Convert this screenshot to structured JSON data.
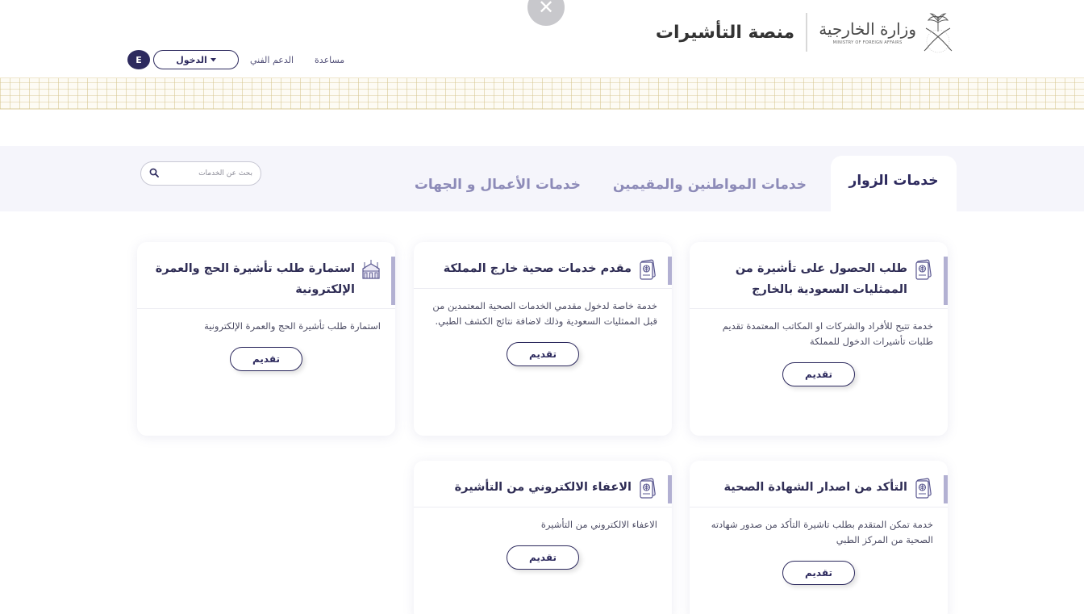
{
  "header": {
    "close_symbol": "✕",
    "ministry_name_ar": "وزارة الخارجية",
    "ministry_name_en": "MINISTRY OF FOREIGN AFFAIRS",
    "platform_title": "منصة التأشيرات",
    "nav": {
      "help": "مساعدة",
      "support": "الدعم الفني",
      "login": "الدخول",
      "language": "E"
    }
  },
  "tabs": [
    {
      "label": "خدمات الزوار",
      "active": true
    },
    {
      "label": "خدمات المواطنين والمقيمين",
      "active": false
    },
    {
      "label": "خدمات الأعمال و الجهات",
      "active": false
    }
  ],
  "search": {
    "placeholder": "بحث عن الخدمات",
    "icon": "search-icon"
  },
  "cards": [
    {
      "title": "طلب الحصول على تأشيرة من الممثليات السعودية بالخارج",
      "description": "خدمة تتيح للأفراد والشركات او المكاتب المعتمدة تقديم طلبات تأشيرات الدخول للمملكة",
      "button": "تقديم",
      "icon": "passport-icon"
    },
    {
      "title": "مقدم خدمات صحية خارج المملكة",
      "description": "خدمة خاصة لدخول مقدمي الخدمات الصحية المعتمدين من قبل الممثليات السعودية وذلك لاضافة نتائج الكشف الطبي.",
      "button": "تقديم",
      "icon": "passport-icon"
    },
    {
      "title": "استمارة طلب تأشيرة الحج والعمرة الإلكترونية",
      "description": "استمارة طلب تأشيرة الحج والعمرة الإلكترونية",
      "button": "تقديم",
      "icon": "kaaba-icon"
    },
    {
      "title": "التأكد من اصدار الشهادة الصحية",
      "description": "خدمة تمكن المتقدم بطلب تاشيرة التأكد من صدور شهادته الصحية من المركز الطبي",
      "button": "تقديم",
      "icon": "passport-icon"
    },
    {
      "title": "الاعفاء الالكتروني من التأشيرة",
      "description": "الاعفاء الالكتروني من التأشيرة",
      "button": "تقديم",
      "icon": "passport-icon"
    }
  ],
  "colors": {
    "primary": "#2d2a5e",
    "tab_inactive": "#8d8bb8",
    "tabs_band": "#f5f5fb",
    "accent_bar": "#b2b0d2",
    "pattern": "#d5c48c"
  }
}
